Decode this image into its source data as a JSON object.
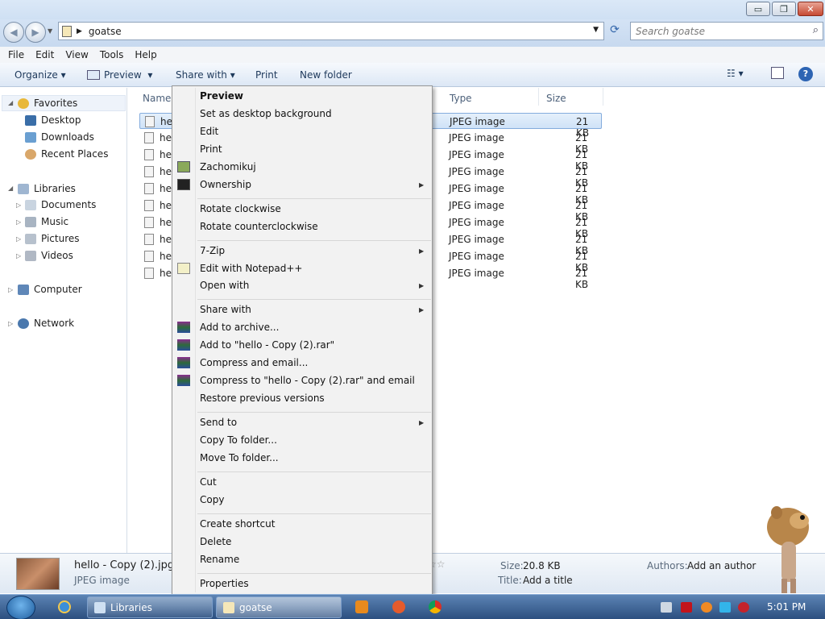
{
  "window": {
    "min": "▭",
    "max": "❐",
    "close": "✕"
  },
  "address": {
    "path": "goatse",
    "search_placeholder": "Search goatse"
  },
  "menubar": [
    "File",
    "Edit",
    "View",
    "Tools",
    "Help"
  ],
  "toolbar": {
    "organize": "Organize",
    "preview": "Preview",
    "share": "Share with",
    "print": "Print",
    "new_folder": "New folder"
  },
  "nav": {
    "favorites": "Favorites",
    "desktop": "Desktop",
    "downloads": "Downloads",
    "recent": "Recent Places",
    "libraries": "Libraries",
    "documents": "Documents",
    "music": "Music",
    "pictures": "Pictures",
    "videos": "Videos",
    "computer": "Computer",
    "network": "Network"
  },
  "columns": {
    "name": "Name",
    "type": "Type",
    "size": "Size"
  },
  "files": [
    {
      "name": "hel",
      "type": "JPEG image",
      "size": "21 KB"
    },
    {
      "name": "hel",
      "type": "JPEG image",
      "size": "21 KB"
    },
    {
      "name": "hel",
      "type": "JPEG image",
      "size": "21 KB"
    },
    {
      "name": "hel",
      "type": "JPEG image",
      "size": "21 KB"
    },
    {
      "name": "hel",
      "type": "JPEG image",
      "size": "21 KB"
    },
    {
      "name": "hel",
      "type": "JPEG image",
      "size": "21 KB"
    },
    {
      "name": "hel",
      "type": "JPEG image",
      "size": "21 KB"
    },
    {
      "name": "hel",
      "type": "JPEG image",
      "size": "21 KB"
    },
    {
      "name": "hel",
      "type": "JPEG image",
      "size": "21 KB"
    },
    {
      "name": "hel",
      "type": "JPEG image",
      "size": "21 KB"
    }
  ],
  "context_menu": {
    "preview": "Preview",
    "set_bg": "Set as desktop background",
    "edit": "Edit",
    "print": "Print",
    "zachomikuj": "Zachomikuj",
    "ownership": "Ownership",
    "rot_cw": "Rotate clockwise",
    "rot_ccw": "Rotate counterclockwise",
    "zip": "7-Zip",
    "notepad": "Edit with Notepad++",
    "open_with": "Open with",
    "share_with": "Share with",
    "add_archive": "Add to archive...",
    "add_rar": "Add to \"hello - Copy (2).rar\"",
    "compress_email": "Compress and email...",
    "compress_rar_email": "Compress to \"hello - Copy (2).rar\" and email",
    "restore": "Restore previous versions",
    "send_to": "Send to",
    "copy_to": "Copy To folder...",
    "move_to": "Move To folder...",
    "cut": "Cut",
    "copy": "Copy",
    "create_shortcut": "Create shortcut",
    "delete": "Delete",
    "rename": "Rename",
    "properties": "Properties"
  },
  "details": {
    "filename": "hello - Copy (2).jpg",
    "filetype": "JPEG image",
    "size_label": "Size:",
    "size_value": "20.8 KB",
    "title_label": "Title:",
    "title_value": "Add a title",
    "authors_label": "Authors:",
    "authors_value": "Add an author"
  },
  "taskbar": {
    "libraries": "Libraries",
    "goatse": "goatse",
    "time": "5:01 PM"
  }
}
